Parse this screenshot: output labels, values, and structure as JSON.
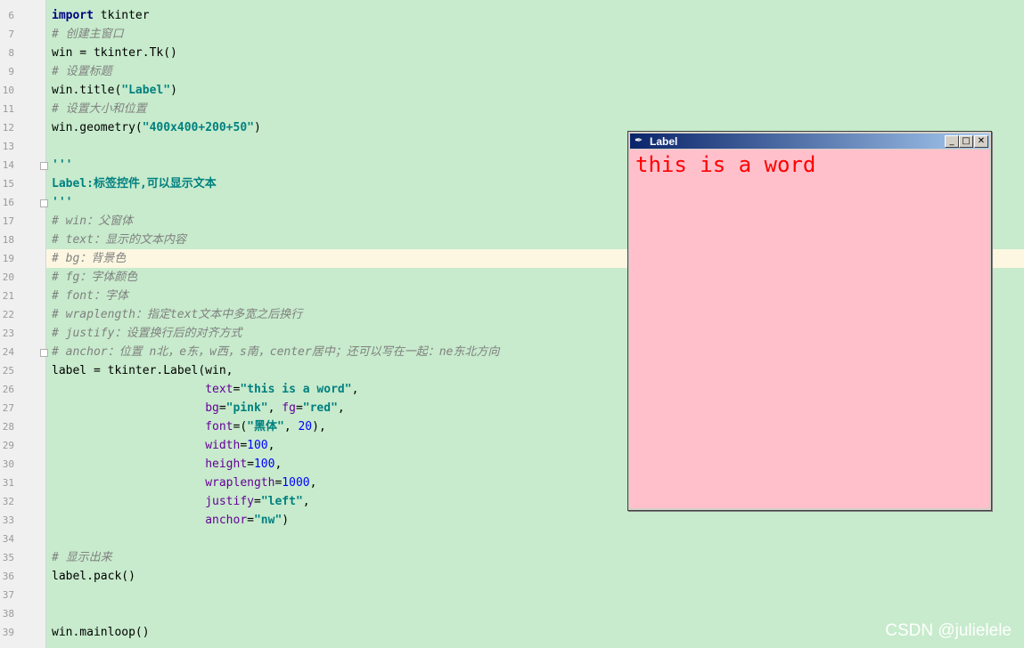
{
  "editor": {
    "lines": [
      {
        "num": "6",
        "tokens": [
          [
            "kw",
            "import"
          ],
          [
            "plain",
            " tkinter"
          ]
        ]
      },
      {
        "num": "7",
        "tokens": [
          [
            "cmt",
            "# 创建主窗口"
          ]
        ]
      },
      {
        "num": "8",
        "tokens": [
          [
            "plain",
            "win = tkinter.Tk()"
          ]
        ]
      },
      {
        "num": "9",
        "tokens": [
          [
            "cmt",
            "# 设置标题"
          ]
        ]
      },
      {
        "num": "10",
        "tokens": [
          [
            "plain",
            "win.title("
          ],
          [
            "str",
            "\"Label\""
          ],
          [
            "plain",
            ")"
          ]
        ]
      },
      {
        "num": "11",
        "tokens": [
          [
            "cmt",
            "# 设置大小和位置"
          ]
        ]
      },
      {
        "num": "12",
        "tokens": [
          [
            "plain",
            "win.geometry("
          ],
          [
            "str",
            "\"400x400+200+50\""
          ],
          [
            "plain",
            ")"
          ]
        ]
      },
      {
        "num": "13",
        "tokens": []
      },
      {
        "num": "14",
        "tokens": [
          [
            "doc",
            "'''"
          ]
        ]
      },
      {
        "num": "15",
        "tokens": [
          [
            "doc",
            "Label:标签控件,可以显示文本"
          ]
        ]
      },
      {
        "num": "16",
        "tokens": [
          [
            "doc",
            "'''"
          ]
        ]
      },
      {
        "num": "17",
        "tokens": [
          [
            "cmt",
            "# win：父窗体"
          ]
        ]
      },
      {
        "num": "18",
        "tokens": [
          [
            "cmt",
            "# text：显示的文本内容"
          ]
        ]
      },
      {
        "num": "19",
        "tokens": [
          [
            "cmt",
            "# bg：背景色"
          ]
        ]
      },
      {
        "num": "20",
        "tokens": [
          [
            "cmt",
            "# fg：字体颜色"
          ]
        ]
      },
      {
        "num": "21",
        "tokens": [
          [
            "cmt",
            "# font：字体"
          ]
        ]
      },
      {
        "num": "22",
        "tokens": [
          [
            "cmt",
            "# wraplength：指定text文本中多宽之后换行"
          ]
        ]
      },
      {
        "num": "23",
        "tokens": [
          [
            "cmt",
            "# justify：设置换行后的对齐方式"
          ]
        ]
      },
      {
        "num": "24",
        "tokens": [
          [
            "cmt",
            "# anchor：位置 n北，e东，w西，s南，center居中；还可以写在一起：ne东北方向"
          ]
        ]
      },
      {
        "num": "25",
        "tokens": [
          [
            "plain",
            "label = tkinter.Label(win,"
          ]
        ]
      },
      {
        "num": "26",
        "tokens": [
          [
            "plain",
            "                      "
          ],
          [
            "kwarg",
            "text"
          ],
          [
            "plain",
            "="
          ],
          [
            "str",
            "\"this is a word\""
          ],
          [
            "plain",
            ","
          ]
        ]
      },
      {
        "num": "27",
        "tokens": [
          [
            "plain",
            "                      "
          ],
          [
            "kwarg",
            "bg"
          ],
          [
            "plain",
            "="
          ],
          [
            "str",
            "\"pink\""
          ],
          [
            "plain",
            ", "
          ],
          [
            "kwarg",
            "fg"
          ],
          [
            "plain",
            "="
          ],
          [
            "str",
            "\"red\""
          ],
          [
            "plain",
            ","
          ]
        ]
      },
      {
        "num": "28",
        "tokens": [
          [
            "plain",
            "                      "
          ],
          [
            "kwarg",
            "font"
          ],
          [
            "plain",
            "=("
          ],
          [
            "str",
            "\"黑体\""
          ],
          [
            "plain",
            ", "
          ],
          [
            "num",
            "20"
          ],
          [
            "plain",
            "),"
          ]
        ]
      },
      {
        "num": "29",
        "tokens": [
          [
            "plain",
            "                      "
          ],
          [
            "kwarg",
            "width"
          ],
          [
            "plain",
            "="
          ],
          [
            "num",
            "100"
          ],
          [
            "plain",
            ","
          ]
        ]
      },
      {
        "num": "30",
        "tokens": [
          [
            "plain",
            "                      "
          ],
          [
            "kwarg",
            "height"
          ],
          [
            "plain",
            "="
          ],
          [
            "num",
            "100"
          ],
          [
            "plain",
            ","
          ]
        ]
      },
      {
        "num": "31",
        "tokens": [
          [
            "plain",
            "                      "
          ],
          [
            "kwarg",
            "wraplength"
          ],
          [
            "plain",
            "="
          ],
          [
            "num",
            "1000"
          ],
          [
            "plain",
            ","
          ]
        ]
      },
      {
        "num": "32",
        "tokens": [
          [
            "plain",
            "                      "
          ],
          [
            "kwarg",
            "justify"
          ],
          [
            "plain",
            "="
          ],
          [
            "str",
            "\"left\""
          ],
          [
            "plain",
            ","
          ]
        ]
      },
      {
        "num": "33",
        "tokens": [
          [
            "plain",
            "                      "
          ],
          [
            "kwarg",
            "anchor"
          ],
          [
            "plain",
            "="
          ],
          [
            "str",
            "\"nw\""
          ],
          [
            "plain",
            ")"
          ]
        ]
      },
      {
        "num": "34",
        "tokens": []
      },
      {
        "num": "35",
        "tokens": [
          [
            "cmt",
            "# 显示出来"
          ]
        ]
      },
      {
        "num": "36",
        "tokens": [
          [
            "plain",
            "label.pack()"
          ]
        ]
      },
      {
        "num": "37",
        "tokens": []
      },
      {
        "num": "38",
        "tokens": []
      },
      {
        "num": "39",
        "tokens": [
          [
            "plain",
            "win.mainloop()"
          ]
        ]
      }
    ],
    "highlighted_line": "19",
    "fold_lines": [
      "14",
      "16",
      "24"
    ]
  },
  "tk_window": {
    "title": "Label",
    "label_text": "this is a word",
    "buttons": {
      "minimize": "_",
      "maximize": "□",
      "close": "✕"
    },
    "colors": {
      "bg": "#ffc0cb",
      "fg": "#ff0000"
    }
  },
  "watermark": "CSDN @julielele"
}
